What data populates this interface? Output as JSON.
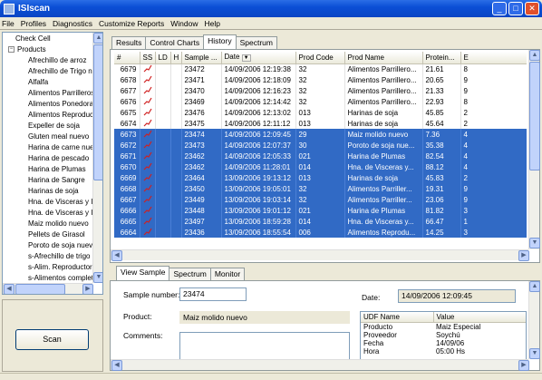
{
  "window": {
    "title": "ISIscan",
    "minimize": "_",
    "maximize": "□",
    "close": "✕"
  },
  "menu": [
    "File",
    "Profiles",
    "Diagnostics",
    "Customize Reports",
    "Window",
    "Help"
  ],
  "tree": {
    "check_cell": "Check Cell",
    "products": "Products",
    "items": [
      "Afrechillo de arroz",
      "Afrechillo de Trigo n",
      "Alfalfa",
      "Alimentos Parrilleros",
      "Alimentos Ponedora",
      "Alimentos Reproduc",
      "Expeller de soja",
      "Gluten meal nuevo",
      "Harina de carne nue",
      "Harina de pescado",
      "Harina de Plumas",
      "Harina de Sangre",
      "Harinas de soja",
      "Hna. de Visceras y I",
      "Hna. de Visceras y I",
      "Maiz molido nuevo",
      "Pellets de Girasol",
      "Poroto de soja nuev",
      "s-Afrechillo de trigo",
      "s-Alim. Reproductor",
      "s-Alimentos complet"
    ]
  },
  "scan_button": "Scan",
  "tabs": [
    "Results",
    "Control Charts",
    "History",
    "Spectrum"
  ],
  "grid": {
    "headers": [
      "#",
      "SS",
      "LD",
      "H",
      "Sample ...",
      "Date",
      "Prod Code",
      "Prod Name",
      "Protein...",
      "E"
    ],
    "rows": [
      [
        "6679",
        "23472",
        "14/09/2006 12:19:38",
        "32",
        "Alimentos Parrillero...",
        "21.61",
        "8"
      ],
      [
        "6678",
        "23471",
        "14/09/2006 12:18:09",
        "32",
        "Alimentos Parrillero...",
        "20.65",
        "9"
      ],
      [
        "6677",
        "23470",
        "14/09/2006 12:16:23",
        "32",
        "Alimentos Parrillero...",
        "21.33",
        "9"
      ],
      [
        "6676",
        "23469",
        "14/09/2006 12:14:42",
        "32",
        "Alimentos Parrillero...",
        "22.93",
        "8"
      ],
      [
        "6675",
        "23476",
        "14/09/2006 12:13:02",
        "013",
        "Harinas de soja",
        "45.85",
        "2"
      ],
      [
        "6674",
        "23475",
        "14/09/2006 12:11:12",
        "013",
        "Harinas de soja",
        "45.64",
        "2"
      ],
      [
        "6673",
        "23474",
        "14/09/2006 12:09:45",
        "29",
        "Maiz molido nuevo",
        "7.36",
        "4"
      ],
      [
        "6672",
        "23473",
        "14/09/2006 12:07:37",
        "30",
        "Poroto de soja nue...",
        "35.38",
        "4"
      ],
      [
        "6671",
        "23462",
        "14/09/2006 12:05:33",
        "021",
        "Harina de Plumas",
        "82.54",
        "4"
      ],
      [
        "6670",
        "23462",
        "14/09/2006 11:28:01",
        "014",
        "Hna. de Visceras y...",
        "88.12",
        "4"
      ],
      [
        "6669",
        "23464",
        "13/09/2006 19:13:12",
        "013",
        "Harinas de soja",
        "45.83",
        "2"
      ],
      [
        "6668",
        "23450",
        "13/09/2006 19:05:01",
        "32",
        "Alimentos Parriller...",
        "19.31",
        "9"
      ],
      [
        "6667",
        "23449",
        "13/09/2006 19:03:14",
        "32",
        "Alimentos Parriller...",
        "23.06",
        "9"
      ],
      [
        "6666",
        "23448",
        "13/09/2006 19:01:12",
        "021",
        "Harina de Plumas",
        "81.82",
        "3"
      ],
      [
        "6665",
        "23497",
        "13/09/2006 18:59:28",
        "014",
        "Hna. de Visceras y...",
        "66.47",
        "1"
      ],
      [
        "6664",
        "23436",
        "13/09/2006 18:55:54",
        "006",
        "Alimentos Reprodu...",
        "14.25",
        "3"
      ]
    ]
  },
  "detail": {
    "tabs": [
      "View Sample",
      "Spectrum",
      "Monitor"
    ],
    "sample_number_label": "Sample number:",
    "sample_number": "23474",
    "date_label": "Date:",
    "date": "14/09/2006 12:09:45",
    "product_label": "Product:",
    "product": "Maiz molido nuevo",
    "comments_label": "Comments:",
    "udf_headers": [
      "UDF Name",
      "Value"
    ],
    "udf_rows": [
      [
        "Producto",
        "Maiz Especial"
      ],
      [
        "Proveedor",
        "Soychú"
      ],
      [
        "Fecha",
        "14/09/06"
      ],
      [
        "Hora",
        "05:00 Hs"
      ]
    ]
  },
  "colors": {
    "selection": "#316ac5",
    "titlebar": "#0b4fd6",
    "spark": "#d02020"
  }
}
